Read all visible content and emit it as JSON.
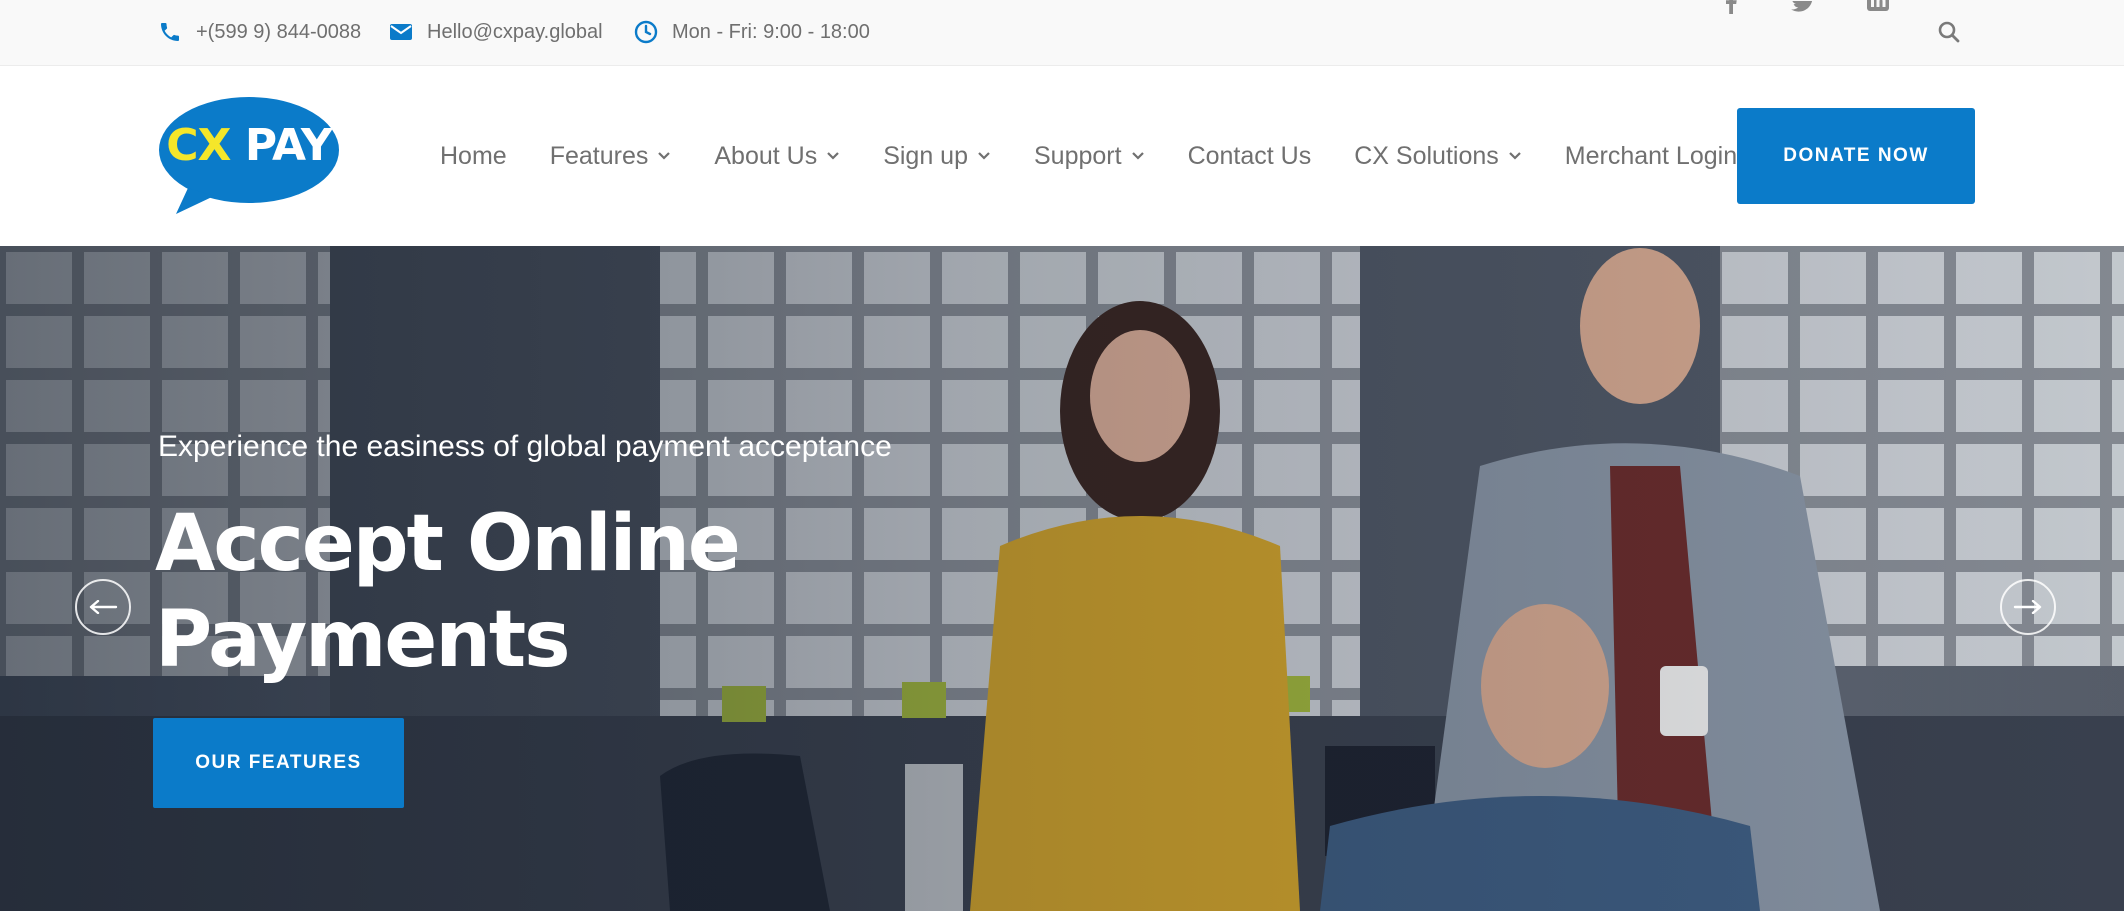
{
  "topbar": {
    "phone": "+(599 9) 844-0088",
    "email": "Hello@cxpay.global",
    "hours": "Mon - Fri: 9:00 - 18:00",
    "social": [
      "facebook-icon",
      "twitter-icon",
      "linkedin-icon"
    ],
    "search_icon": "search-icon"
  },
  "header": {
    "logo": {
      "cx": "CX",
      "pay": "PAY"
    },
    "nav": [
      {
        "label": "Home",
        "dropdown": false
      },
      {
        "label": "Features",
        "dropdown": true
      },
      {
        "label": "About Us",
        "dropdown": true
      },
      {
        "label": "Sign up",
        "dropdown": true
      },
      {
        "label": "Support",
        "dropdown": true
      },
      {
        "label": "Contact Us",
        "dropdown": false
      },
      {
        "label": "CX Solutions",
        "dropdown": true
      },
      {
        "label": "Merchant Login",
        "dropdown": false
      }
    ],
    "donate_label": "DONATE NOW"
  },
  "hero": {
    "subtitle": "Experience the easiness of global payment acceptance",
    "title_line1": "Accept Online",
    "title_line2": "Payments",
    "cta_label": "OUR FEATURES",
    "prev_icon": "arrow-left-icon",
    "next_icon": "arrow-right-icon"
  },
  "colors": {
    "accent": "#0b7bc9",
    "logo_yellow": "#f5e62a",
    "nav_text": "#707070",
    "topbar_bg": "#f9f9f9"
  }
}
